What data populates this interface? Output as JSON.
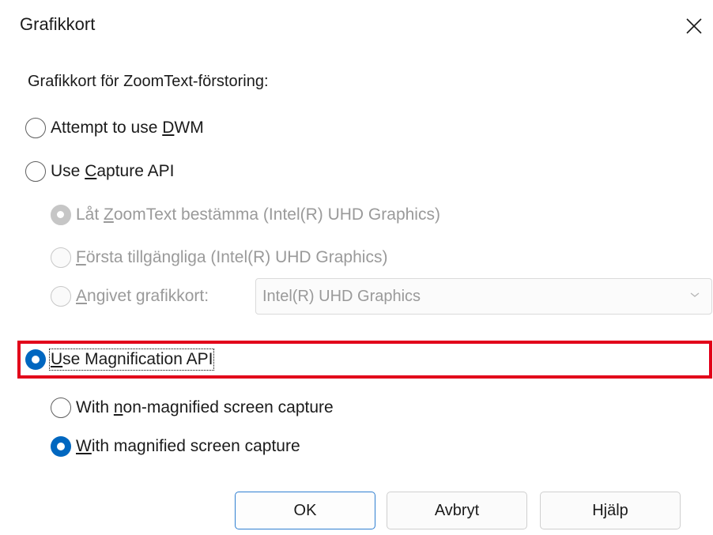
{
  "dialog": {
    "title": "Grafikkort",
    "group_label": "Grafikkort för ZoomText-förstoring:"
  },
  "options": {
    "dwm": {
      "pre": "Attempt to use ",
      "key": "D",
      "post": "WM",
      "selected": false,
      "enabled": true
    },
    "capture_api": {
      "pre": "Use ",
      "key": "C",
      "post": "apture API",
      "selected": false,
      "enabled": true
    },
    "capture_auto": {
      "pre": "Låt ",
      "key": "Z",
      "post": "oomText bestämma (Intel(R) UHD Graphics)",
      "selected": true,
      "enabled": false
    },
    "capture_first": {
      "pre": "",
      "key": "F",
      "post": "örsta tillgängliga (Intel(R) UHD Graphics)",
      "selected": false,
      "enabled": false
    },
    "capture_specified": {
      "pre": "",
      "key": "A",
      "post": "ngivet grafikkort:",
      "selected": false,
      "enabled": false
    },
    "magnification_api": {
      "pre": "",
      "key": "U",
      "post": "se Magnification API",
      "selected": true,
      "enabled": true
    },
    "non_magnified_capture": {
      "pre": "With ",
      "key": "n",
      "post": "on-magnified screen capture",
      "selected": false,
      "enabled": true
    },
    "magnified_capture": {
      "pre": "",
      "key": "W",
      "post": "ith magnified screen capture",
      "selected": true,
      "enabled": true
    }
  },
  "graphics_dropdown": {
    "value": "Intel(R) UHD Graphics",
    "enabled": false
  },
  "buttons": {
    "ok": "OK",
    "cancel": "Avbryt",
    "help": "Hjälp"
  },
  "colors": {
    "accent": "#0067c0",
    "highlight_border": "#e2001a",
    "disabled_text": "#9a9a9a"
  },
  "icons": {
    "close": "close-icon",
    "dropdown": "chevron-down-icon"
  }
}
